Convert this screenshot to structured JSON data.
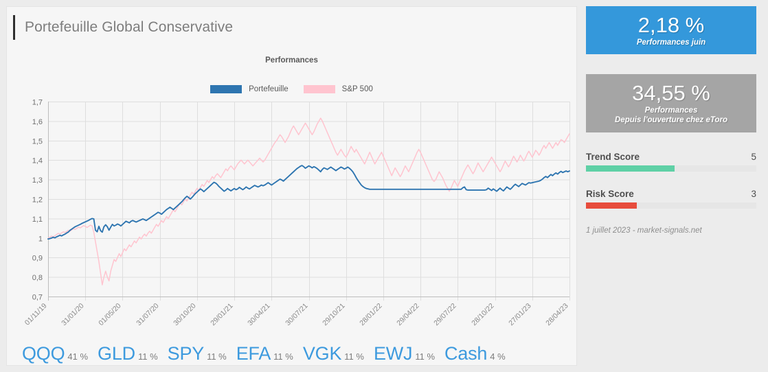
{
  "header": {
    "title": "Portefeuille Global Conservative",
    "accent_color": "#2f2f2f"
  },
  "chart_data": {
    "type": "line",
    "title": "Performances",
    "xlabel": "",
    "ylabel": "",
    "grid": true,
    "legend_position": "top-center",
    "ylim": [
      0.7,
      1.7
    ],
    "ytick_labels": [
      "1,7",
      "1,6",
      "1,5",
      "1,4",
      "1,3",
      "1,2",
      "1,1",
      "1",
      "0,9",
      "0,8",
      "0,7"
    ],
    "yticks": [
      1.7,
      1.6,
      1.5,
      1.4,
      1.3,
      1.2,
      1.1,
      1.0,
      0.9,
      0.8,
      0.7
    ],
    "xtick_labels": [
      "01/11/19",
      "31/01/20",
      "01/05/20",
      "31/07/20",
      "30/10/20",
      "29/01/21",
      "30/04/21",
      "30/07/21",
      "29/10/21",
      "28/01/22",
      "29/04/22",
      "29/07/22",
      "28/10/22",
      "27/01/23",
      "28/04/23"
    ],
    "series": [
      {
        "name": "Portefeuille",
        "color": "#2e75b0",
        "values": [
          0.995,
          0.997,
          1.0,
          1.004,
          1.001,
          1.006,
          1.01,
          1.014,
          1.011,
          1.016,
          1.02,
          1.026,
          1.031,
          1.04,
          1.046,
          1.052,
          1.058,
          1.062,
          1.066,
          1.07,
          1.075,
          1.079,
          1.083,
          1.087,
          1.091,
          1.096,
          1.1,
          1.098,
          1.04,
          1.032,
          1.06,
          1.038,
          1.03,
          1.058,
          1.068,
          1.058,
          1.04,
          1.056,
          1.07,
          1.062,
          1.066,
          1.072,
          1.068,
          1.062,
          1.07,
          1.078,
          1.086,
          1.082,
          1.078,
          1.086,
          1.09,
          1.086,
          1.082,
          1.086,
          1.09,
          1.094,
          1.098,
          1.094,
          1.09,
          1.096,
          1.102,
          1.108,
          1.114,
          1.12,
          1.126,
          1.132,
          1.128,
          1.122,
          1.13,
          1.138,
          1.146,
          1.152,
          1.158,
          1.152,
          1.146,
          1.154,
          1.162,
          1.17,
          1.178,
          1.186,
          1.196,
          1.206,
          1.214,
          1.208,
          1.2,
          1.208,
          1.218,
          1.228,
          1.236,
          1.244,
          1.252,
          1.246,
          1.238,
          1.246,
          1.254,
          1.262,
          1.27,
          1.278,
          1.286,
          1.282,
          1.274,
          1.264,
          1.256,
          1.248,
          1.24,
          1.246,
          1.254,
          1.248,
          1.242,
          1.248,
          1.254,
          1.248,
          1.252,
          1.26,
          1.254,
          1.248,
          1.254,
          1.262,
          1.256,
          1.252,
          1.258,
          1.264,
          1.27,
          1.266,
          1.262,
          1.266,
          1.272,
          1.268,
          1.272,
          1.278,
          1.284,
          1.278,
          1.272,
          1.278,
          1.284,
          1.29,
          1.296,
          1.302,
          1.298,
          1.292,
          1.3,
          1.308,
          1.316,
          1.324,
          1.332,
          1.34,
          1.348,
          1.356,
          1.362,
          1.368,
          1.372,
          1.366,
          1.358,
          1.364,
          1.37,
          1.366,
          1.36,
          1.366,
          1.362,
          1.356,
          1.348,
          1.34,
          1.352,
          1.36,
          1.356,
          1.352,
          1.358,
          1.364,
          1.358,
          1.352,
          1.346,
          1.352,
          1.358,
          1.364,
          1.36,
          1.354,
          1.358,
          1.364,
          1.358,
          1.35,
          1.34,
          1.326,
          1.31,
          1.296,
          1.284,
          1.272,
          1.264,
          1.258,
          1.254,
          1.252,
          1.25,
          1.25,
          1.25,
          1.25,
          1.25,
          1.25,
          1.25,
          1.25,
          1.25,
          1.25,
          1.25,
          1.25,
          1.25,
          1.25,
          1.25,
          1.25,
          1.25,
          1.25,
          1.25,
          1.25,
          1.25,
          1.25,
          1.25,
          1.25,
          1.25,
          1.25,
          1.25,
          1.25,
          1.25,
          1.25,
          1.25,
          1.25,
          1.25,
          1.25,
          1.25,
          1.25,
          1.25,
          1.25,
          1.25,
          1.25,
          1.25,
          1.25,
          1.25,
          1.25,
          1.25,
          1.25,
          1.25,
          1.25,
          1.25,
          1.25,
          1.25,
          1.25,
          1.25,
          1.25,
          1.25,
          1.258,
          1.262,
          1.248,
          1.246,
          1.246,
          1.246,
          1.246,
          1.246,
          1.246,
          1.246,
          1.246,
          1.246,
          1.246,
          1.246,
          1.248,
          1.256,
          1.25,
          1.244,
          1.252,
          1.246,
          1.24,
          1.248,
          1.256,
          1.248,
          1.242,
          1.252,
          1.262,
          1.256,
          1.25,
          1.258,
          1.268,
          1.276,
          1.27,
          1.264,
          1.272,
          1.28,
          1.276,
          1.272,
          1.278,
          1.284,
          1.282,
          1.284,
          1.286,
          1.288,
          1.29,
          1.292,
          1.296,
          1.302,
          1.31,
          1.316,
          1.31,
          1.318,
          1.326,
          1.32,
          1.328,
          1.334,
          1.328,
          1.336,
          1.342,
          1.336,
          1.34,
          1.344,
          1.34,
          1.344
        ]
      },
      {
        "name": "S&P 500",
        "color": "#ffc4cf",
        "values": [
          0.998,
          1.004,
          1.01,
          1.006,
          1.012,
          1.018,
          1.024,
          1.02,
          1.026,
          1.032,
          1.028,
          1.034,
          1.04,
          1.036,
          1.042,
          1.048,
          1.044,
          1.05,
          1.056,
          1.052,
          1.058,
          1.064,
          1.06,
          1.054,
          1.06,
          1.066,
          1.062,
          1.03,
          0.98,
          0.93,
          0.88,
          0.82,
          0.76,
          0.8,
          0.83,
          0.8,
          0.78,
          0.83,
          0.86,
          0.89,
          0.88,
          0.9,
          0.92,
          0.905,
          0.925,
          0.945,
          0.935,
          0.95,
          0.965,
          0.955,
          0.97,
          0.985,
          0.975,
          0.99,
          1.005,
          0.995,
          1.01,
          1.02,
          1.01,
          1.025,
          1.035,
          1.025,
          1.04,
          1.055,
          1.07,
          1.06,
          1.075,
          1.09,
          1.08,
          1.095,
          1.11,
          1.1,
          1.115,
          1.13,
          1.145,
          1.135,
          1.15,
          1.165,
          1.18,
          1.17,
          1.185,
          1.2,
          1.19,
          1.205,
          1.22,
          1.235,
          1.225,
          1.24,
          1.255,
          1.245,
          1.26,
          1.275,
          1.265,
          1.28,
          1.295,
          1.285,
          1.3,
          1.315,
          1.305,
          1.32,
          1.33,
          1.32,
          1.31,
          1.325,
          1.34,
          1.355,
          1.345,
          1.36,
          1.37,
          1.36,
          1.35,
          1.365,
          1.38,
          1.39,
          1.4,
          1.39,
          1.38,
          1.39,
          1.4,
          1.39,
          1.38,
          1.37,
          1.38,
          1.39,
          1.4,
          1.41,
          1.4,
          1.39,
          1.4,
          1.415,
          1.43,
          1.445,
          1.46,
          1.475,
          1.49,
          1.5,
          1.515,
          1.53,
          1.52,
          1.505,
          1.49,
          1.505,
          1.52,
          1.54,
          1.56,
          1.575,
          1.56,
          1.545,
          1.53,
          1.545,
          1.56,
          1.575,
          1.59,
          1.575,
          1.56,
          1.545,
          1.53,
          1.545,
          1.565,
          1.585,
          1.6,
          1.615,
          1.6,
          1.58,
          1.56,
          1.54,
          1.52,
          1.5,
          1.48,
          1.46,
          1.44,
          1.425,
          1.44,
          1.455,
          1.44,
          1.425,
          1.415,
          1.43,
          1.45,
          1.47,
          1.455,
          1.44,
          1.455,
          1.44,
          1.425,
          1.41,
          1.395,
          1.38,
          1.4,
          1.42,
          1.44,
          1.42,
          1.4,
          1.38,
          1.395,
          1.41,
          1.425,
          1.44,
          1.42,
          1.4,
          1.38,
          1.36,
          1.34,
          1.32,
          1.34,
          1.36,
          1.345,
          1.33,
          1.315,
          1.33,
          1.35,
          1.37,
          1.355,
          1.34,
          1.36,
          1.38,
          1.4,
          1.42,
          1.44,
          1.455,
          1.44,
          1.42,
          1.4,
          1.38,
          1.36,
          1.34,
          1.32,
          1.3,
          1.29,
          1.3,
          1.32,
          1.34,
          1.325,
          1.31,
          1.29,
          1.27,
          1.255,
          1.24,
          1.255,
          1.275,
          1.295,
          1.28,
          1.265,
          1.285,
          1.305,
          1.325,
          1.345,
          1.36,
          1.375,
          1.36,
          1.345,
          1.33,
          1.345,
          1.365,
          1.385,
          1.37,
          1.355,
          1.34,
          1.355,
          1.37,
          1.385,
          1.4,
          1.415,
          1.4,
          1.385,
          1.37,
          1.355,
          1.34,
          1.355,
          1.375,
          1.395,
          1.38,
          1.365,
          1.38,
          1.4,
          1.42,
          1.405,
          1.39,
          1.405,
          1.425,
          1.41,
          1.395,
          1.41,
          1.43,
          1.445,
          1.43,
          1.415,
          1.43,
          1.45,
          1.44,
          1.425,
          1.44,
          1.46,
          1.475,
          1.46,
          1.475,
          1.49,
          1.475,
          1.46,
          1.475,
          1.49,
          1.475,
          1.49,
          1.505,
          1.5,
          1.49,
          1.505,
          1.52,
          1.535
        ]
      }
    ]
  },
  "legend": [
    {
      "label": "Portefeuille",
      "color": "#2e75b0"
    },
    {
      "label": "S&P 500",
      "color": "#ffc4cf"
    }
  ],
  "holdings": [
    {
      "ticker": "QQQ",
      "weight": "41 %"
    },
    {
      "ticker": "GLD",
      "weight": "11 %"
    },
    {
      "ticker": "SPY",
      "weight": "11 %"
    },
    {
      "ticker": "EFA",
      "weight": "11 %"
    },
    {
      "ticker": "VGK",
      "weight": "11 %"
    },
    {
      "ticker": "EWJ",
      "weight": "11 %"
    },
    {
      "ticker": "Cash",
      "weight": "4 %"
    }
  ],
  "stats": [
    {
      "value": "2,18 %",
      "label_line1": "Performances juin",
      "label_line2": "",
      "bg": "#3498db"
    },
    {
      "value": "34,55 %",
      "label_line1": "Performances",
      "label_line2": "Depuis l'ouverture chez eToro",
      "bg": "#a5a5a5"
    }
  ],
  "scores": [
    {
      "name": "Trend Score",
      "value": "5",
      "percent": 52,
      "color": "#5fd0a6"
    },
    {
      "name": "Risk Score",
      "value": "3",
      "percent": 30,
      "color": "#e74c3c"
    }
  ],
  "footer": {
    "note": "1 juillet 2023 - market-signals.net"
  }
}
